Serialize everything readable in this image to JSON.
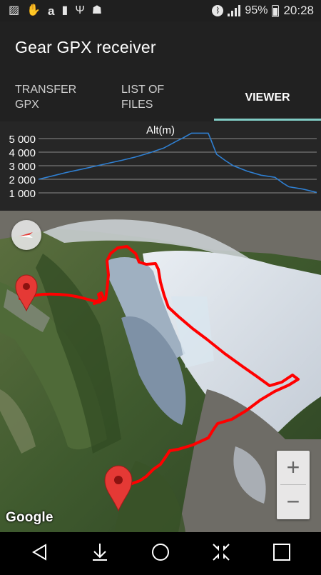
{
  "status_bar": {
    "left_icons": [
      "image-icon",
      "hand-icon",
      "amazon-icon",
      "sd-card-icon",
      "usb-icon",
      "android-debug-icon"
    ],
    "battery_percent": "95%",
    "time": "20:28"
  },
  "app_bar": {
    "title": "Gear GPX receiver"
  },
  "tabs": [
    {
      "line1": "TRANSFER",
      "line2": "GPX",
      "selected": false
    },
    {
      "line1": "LIST OF",
      "line2": "FILES",
      "selected": false
    },
    {
      "line1": "VIEWER",
      "line2": "",
      "selected": true
    }
  ],
  "accent_color": "#80cbc4",
  "chart_data": {
    "type": "line",
    "title": "Alt(m)",
    "ylim": [
      1000,
      5000
    ],
    "y_ticks": [
      1000,
      2000,
      3000,
      4000,
      5000
    ],
    "y_tick_labels": [
      "1 000",
      "2 000",
      "3 000",
      "4 000",
      "5 000"
    ],
    "x": [
      0,
      5,
      10,
      15,
      20,
      25,
      30,
      35,
      40,
      45,
      50,
      52,
      55,
      57,
      58,
      59,
      60,
      61,
      62,
      64,
      67,
      70,
      75,
      80,
      85,
      88,
      90,
      95,
      100
    ],
    "series": [
      {
        "color": "#2f7fd1",
        "values": [
          2000,
          2250,
          2500,
          2720,
          2950,
          3180,
          3400,
          3650,
          3950,
          4300,
          4850,
          5050,
          5600,
          5800,
          5950,
          5600,
          5550,
          5400,
          4900,
          3850,
          3400,
          3000,
          2600,
          2300,
          2150,
          1700,
          1450,
          1280,
          1030
        ]
      }
    ],
    "grid": true
  },
  "map": {
    "attribution": "Google",
    "zoom_in_label": "+",
    "zoom_out_label": "−",
    "route_color": "#ff0000",
    "marker_color": "#e53935"
  },
  "nav_bar": [
    "back-icon",
    "download-icon",
    "home-icon",
    "collapse-icon",
    "recents-icon"
  ]
}
